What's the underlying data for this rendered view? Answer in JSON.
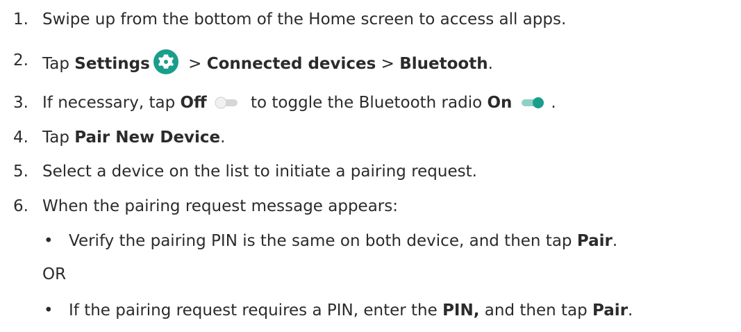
{
  "steps": [
    {
      "num": "1.",
      "text": "Swipe up from the bottom of the Home screen to access all apps."
    },
    {
      "num": "2.",
      "tap": "Tap ",
      "settings": "Settings",
      "sep1": " > ",
      "connected": "Connected devices",
      "sep2": " > ",
      "bluetooth": "Bluetooth",
      "end": "."
    },
    {
      "num": "3.",
      "pre": "If necessary, tap ",
      "off": "Off",
      "mid": " to toggle the Bluetooth radio ",
      "on": "On",
      "end": "."
    },
    {
      "num": "4.",
      "tap": "Tap ",
      "pair_new": "Pair New Device",
      "end": "."
    },
    {
      "num": "5.",
      "text": "Select a device on the list to initiate a pairing request."
    },
    {
      "num": "6.",
      "text": "When the pairing request message appears:"
    }
  ],
  "sub": {
    "bullet1": {
      "symbol": "•",
      "text": "Verify the pairing PIN is the same on both device, and then tap ",
      "pair": "Pair",
      "end": "."
    },
    "or": "OR",
    "bullet2": {
      "symbol": "•",
      "pre": "If the pairing request requires a PIN, enter the ",
      "pin": "PIN,",
      "mid": " and then tap ",
      "pair": "Pair",
      "end": "."
    }
  },
  "icons": {
    "settings_icon": "gear-icon",
    "toggle_off_icon": "toggle-off-icon",
    "toggle_on_icon": "toggle-on-icon",
    "accent": "#1a9e8c",
    "toggle_off_color": "#d3d3d3"
  }
}
